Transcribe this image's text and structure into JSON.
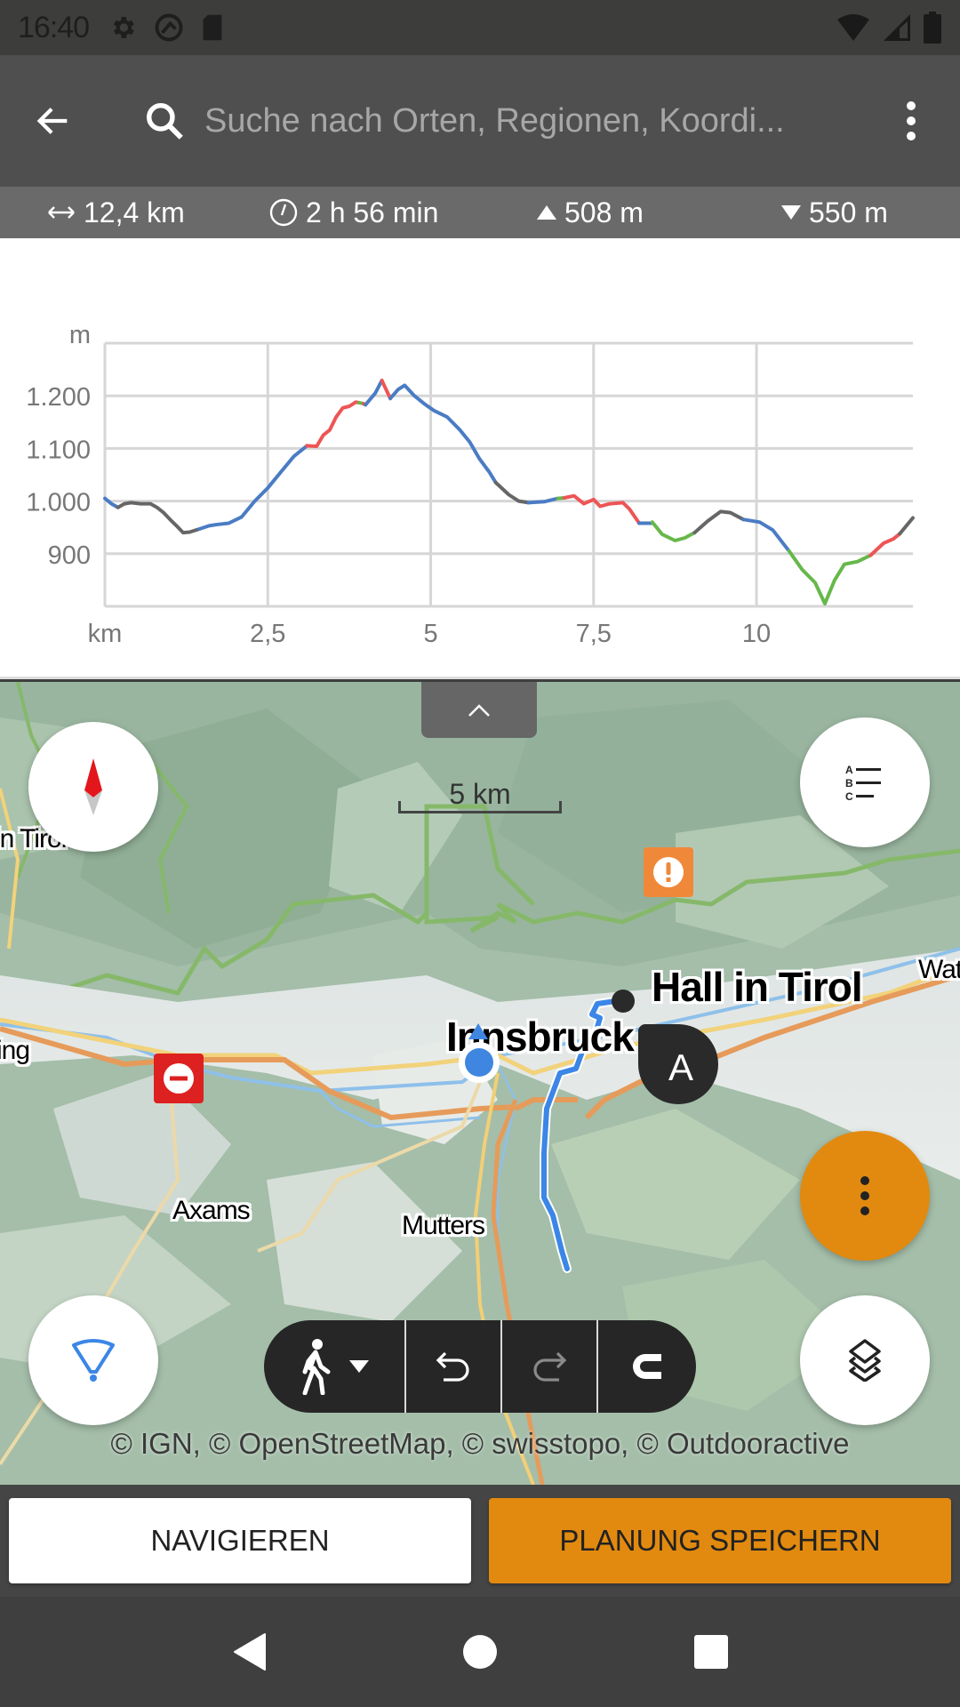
{
  "status_bar": {
    "time": "16:40",
    "left_icons": [
      "settings-icon",
      "vpn-icon",
      "sd-card-icon"
    ],
    "right_icons": [
      "wifi-icon",
      "signal-icon",
      "battery-icon"
    ]
  },
  "app_bar": {
    "back_icon": "arrow-left-icon",
    "search_icon": "search-icon",
    "search_placeholder": "Suche nach Orten, Regionen, Koordi...",
    "menu_icon": "more-vert-icon"
  },
  "stats": {
    "distance": "12,4 km",
    "duration": "2 h 56 min",
    "ascent": "508 m",
    "descent": "550 m"
  },
  "chart_data": {
    "type": "line",
    "title": "",
    "xlabel": "km",
    "ylabel": "m",
    "xlim": [
      0,
      12.4
    ],
    "ylim": [
      800,
      1300
    ],
    "grid": true,
    "x_ticks": [
      {
        "value": 2.5,
        "label": "2,5"
      },
      {
        "value": 5,
        "label": "5"
      },
      {
        "value": 7.5,
        "label": "7,5"
      },
      {
        "value": 10,
        "label": "10"
      }
    ],
    "y_ticks": [
      {
        "value": 900,
        "label": "900"
      },
      {
        "value": 1000,
        "label": "1.000"
      },
      {
        "value": 1100,
        "label": "1.100"
      },
      {
        "value": 1200,
        "label": "1.200"
      }
    ],
    "segment_colors": {
      "blue": "#4a7cc4",
      "gray": "#666666",
      "red": "#ee5555",
      "green": "#66b84a"
    },
    "series": [
      {
        "name": "segment-1",
        "color": "blue",
        "points": [
          [
            0,
            1005
          ],
          [
            0.1,
            995
          ],
          [
            0.2,
            988
          ]
        ]
      },
      {
        "name": "segment-2",
        "color": "gray",
        "points": [
          [
            0.2,
            988
          ],
          [
            0.3,
            995
          ],
          [
            0.4,
            997
          ],
          [
            0.55,
            995
          ],
          [
            0.7,
            995
          ],
          [
            0.8,
            988
          ],
          [
            0.9,
            978
          ],
          [
            1.0,
            965
          ],
          [
            1.1,
            953
          ],
          [
            1.2,
            940
          ],
          [
            1.3,
            941
          ],
          [
            1.45,
            947
          ]
        ]
      },
      {
        "name": "segment-3",
        "color": "blue",
        "points": [
          [
            1.45,
            947
          ],
          [
            1.6,
            953
          ],
          [
            1.7,
            955
          ],
          [
            1.9,
            958
          ],
          [
            2.1,
            970
          ],
          [
            2.3,
            1000
          ],
          [
            2.5,
            1025
          ],
          [
            2.7,
            1055
          ],
          [
            2.9,
            1085
          ],
          [
            3.1,
            1105
          ]
        ]
      },
      {
        "name": "segment-4",
        "color": "red",
        "points": [
          [
            3.1,
            1105
          ],
          [
            3.25,
            1104
          ],
          [
            3.35,
            1125
          ],
          [
            3.45,
            1135
          ],
          [
            3.55,
            1160
          ],
          [
            3.65,
            1177
          ],
          [
            3.75,
            1180
          ],
          [
            3.85,
            1188
          ],
          [
            3.9,
            1187
          ]
        ]
      },
      {
        "name": "segment-5",
        "color": "green",
        "points": [
          [
            3.9,
            1187
          ],
          [
            3.97,
            1185
          ]
        ]
      },
      {
        "name": "segment-6",
        "color": "red",
        "points": [
          [
            3.97,
            1185
          ],
          [
            4.0,
            1183
          ]
        ]
      },
      {
        "name": "segment-7",
        "color": "blue",
        "points": [
          [
            4.0,
            1183
          ],
          [
            4.15,
            1205
          ],
          [
            4.25,
            1229
          ]
        ]
      },
      {
        "name": "segment-8",
        "color": "red",
        "points": [
          [
            4.25,
            1229
          ],
          [
            4.38,
            1195
          ]
        ]
      },
      {
        "name": "segment-9",
        "color": "blue",
        "points": [
          [
            4.38,
            1195
          ],
          [
            4.5,
            1212
          ],
          [
            4.6,
            1220
          ],
          [
            4.75,
            1200
          ],
          [
            4.9,
            1185
          ],
          [
            5.05,
            1172
          ],
          [
            5.25,
            1160
          ],
          [
            5.45,
            1135
          ],
          [
            5.6,
            1112
          ],
          [
            5.75,
            1080
          ],
          [
            5.9,
            1055
          ],
          [
            6.0,
            1035
          ]
        ]
      },
      {
        "name": "segment-10",
        "color": "gray",
        "points": [
          [
            6.0,
            1035
          ],
          [
            6.2,
            1012
          ],
          [
            6.35,
            1000
          ],
          [
            6.5,
            997
          ]
        ]
      },
      {
        "name": "segment-11",
        "color": "blue",
        "points": [
          [
            6.5,
            997
          ],
          [
            6.75,
            999
          ],
          [
            6.95,
            1005
          ]
        ]
      },
      {
        "name": "segment-12",
        "color": "green",
        "points": [
          [
            6.95,
            1005
          ],
          [
            7.05,
            1006
          ]
        ]
      },
      {
        "name": "segment-13",
        "color": "red",
        "points": [
          [
            7.05,
            1006
          ],
          [
            7.2,
            1010
          ],
          [
            7.35,
            995
          ],
          [
            7.5,
            1003
          ],
          [
            7.6,
            990
          ],
          [
            7.75,
            995
          ],
          [
            7.95,
            997
          ],
          [
            8.05,
            985
          ],
          [
            8.2,
            958
          ]
        ]
      },
      {
        "name": "segment-14",
        "color": "blue",
        "points": [
          [
            8.2,
            958
          ],
          [
            8.4,
            958
          ]
        ]
      },
      {
        "name": "segment-15",
        "color": "green",
        "points": [
          [
            8.4,
            960
          ],
          [
            8.55,
            937
          ],
          [
            8.75,
            925
          ],
          [
            8.9,
            930
          ],
          [
            9.05,
            940
          ]
        ]
      },
      {
        "name": "segment-16",
        "color": "gray",
        "points": [
          [
            9.05,
            940
          ],
          [
            9.25,
            962
          ],
          [
            9.45,
            980
          ],
          [
            9.6,
            978
          ],
          [
            9.8,
            965
          ]
        ]
      },
      {
        "name": "segment-17",
        "color": "blue",
        "points": [
          [
            9.8,
            965
          ],
          [
            10.05,
            960
          ],
          [
            10.25,
            945
          ],
          [
            10.5,
            905
          ]
        ]
      },
      {
        "name": "segment-18",
        "color": "green",
        "points": [
          [
            10.5,
            905
          ],
          [
            10.7,
            870
          ],
          [
            10.9,
            845
          ],
          [
            11.05,
            805
          ],
          [
            11.2,
            850
          ],
          [
            11.35,
            880
          ],
          [
            11.55,
            885
          ],
          [
            11.75,
            897
          ]
        ]
      },
      {
        "name": "segment-19",
        "color": "red",
        "points": [
          [
            11.75,
            897
          ],
          [
            11.95,
            920
          ],
          [
            12.1,
            928
          ],
          [
            12.2,
            938
          ]
        ]
      },
      {
        "name": "segment-20",
        "color": "gray",
        "points": [
          [
            12.2,
            938
          ],
          [
            12.4,
            968
          ]
        ]
      }
    ]
  },
  "map": {
    "profile_toggle_icon": "chevron-up-icon",
    "compass_icon": "compass-icon",
    "waypoint_list_icon": "abc-list-icon",
    "scale_label": "5 km",
    "warning_marker_icon": "exclamation-icon",
    "closure_marker_icon": "no-entry-icon",
    "places": [
      {
        "name": "Innsbruck",
        "size": "big"
      },
      {
        "name": "Hall in Tirol",
        "size": "big"
      },
      {
        "name": "Axams",
        "size": "small"
      },
      {
        "name": "Mutters",
        "size": "small"
      },
      {
        "name": "Wat",
        "size": "small"
      },
      {
        "name": "in Tirol",
        "size": "small"
      },
      {
        "name": "ing",
        "size": "small"
      }
    ],
    "start_marker_label": "A",
    "more_icon": "more-vert-icon",
    "location_icon": "location-cone-icon",
    "layers_icon": "layers-icon",
    "toolbar": {
      "activity_icon": "hiking-icon",
      "dropdown_icon": "caret-down-icon",
      "undo_icon": "undo-icon",
      "redo_icon": "redo-icon",
      "snap_icon": "magnet-icon"
    },
    "attribution": "© IGN, © OpenStreetMap, © swisstopo, © Outdooractive"
  },
  "actions": {
    "navigate_label": "NAVIGIEREN",
    "save_label": "PLANUNG SPEICHERN"
  },
  "colors": {
    "accent": "#e28a0f",
    "route": "#3b86e6",
    "warning": "#f0883a",
    "closure": "#dd2020"
  },
  "nav_bar": {
    "back_icon": "nav-back-icon",
    "home_icon": "nav-home-icon",
    "recents_icon": "nav-recents-icon"
  }
}
